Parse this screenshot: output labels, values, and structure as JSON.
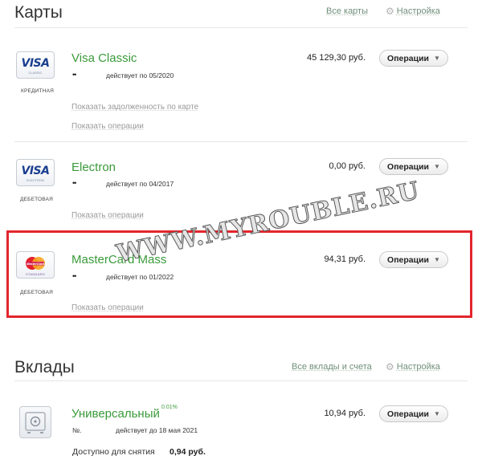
{
  "cards_section": {
    "title": "Карты",
    "all_link": "Все карты",
    "settings_link": "Настройка"
  },
  "cards": [
    {
      "icon": "visa-classic-card-icon",
      "icon_brand": "VISA",
      "icon_sub": "CLASSIC",
      "type": "КРЕДИТНАЯ",
      "name": "Visa Classic",
      "number_mask": "••",
      "validity": "действует по 05/2020",
      "amount": "45 129,30 руб.",
      "ops_label": "Операции",
      "links": [
        "Показать задолженность по карте",
        "Показать операции"
      ]
    },
    {
      "icon": "visa-electron-card-icon",
      "icon_brand": "VISA",
      "icon_sub": "ELECTRON",
      "type": "ДЕБЕТОВАЯ",
      "name": "Electron",
      "number_mask": "••",
      "validity": "действует по 04/2017",
      "amount": "0,00 руб.",
      "ops_label": "Операции",
      "links": [
        "Показать операции"
      ]
    },
    {
      "icon": "mastercard-mass-card-icon",
      "icon_brand": "MasterCard",
      "icon_sub": "STANDARD",
      "type": "ДЕБЕТОВАЯ",
      "name": "MasterCard Mass",
      "number_mask": "••",
      "validity": "действует по 01/2022",
      "amount": "94,31 руб.",
      "ops_label": "Операции",
      "links": [
        "Показать операции"
      ]
    }
  ],
  "watermark": "WWW.MYROUBLE.RU",
  "deposits_section": {
    "title": "Вклады",
    "all_link": "Все вклады и счета",
    "settings_link": "Настройка"
  },
  "deposit": {
    "icon": "safe-icon",
    "name": "Универсальный",
    "rate": "0.01%",
    "number_label": "№.",
    "validity": "действует до 18 мая 2021",
    "amount": "10,94 руб.",
    "ops_label": "Операции",
    "available_label": "Доступно для снятия",
    "available_value": "0,94 руб."
  },
  "colors": {
    "accent_green": "#3a9a3a",
    "highlight_red": "#e2262d",
    "visa_blue": "#1a3f8f"
  }
}
